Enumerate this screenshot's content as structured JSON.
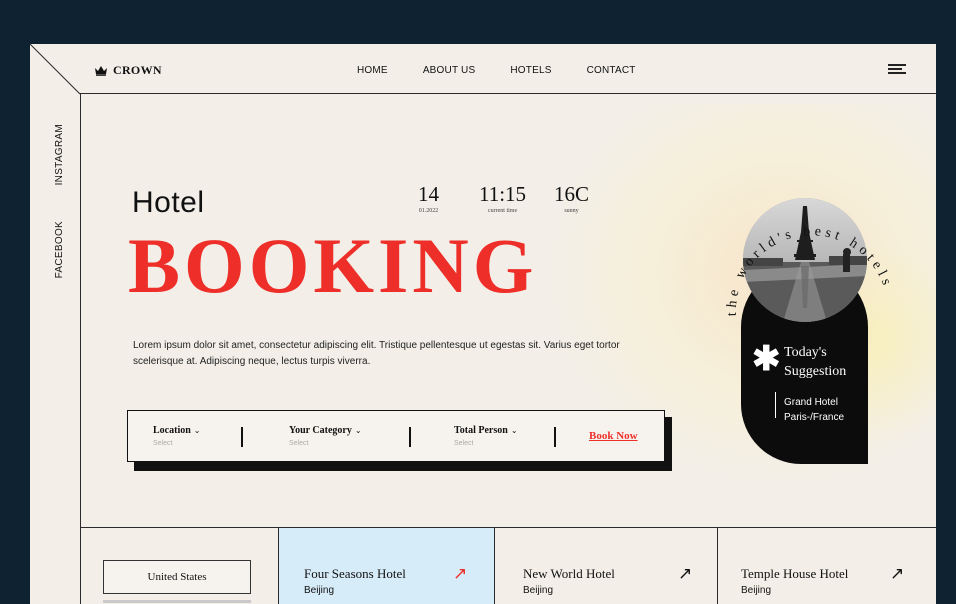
{
  "brand": {
    "name": "CROWN",
    "icon": "crown-icon"
  },
  "nav": [
    "HOME",
    "ABOUT US",
    "HOTELS",
    "CONTACT"
  ],
  "social": {
    "instagram": "INSTAGRAM",
    "facebook": "FACEBOOK"
  },
  "hero": {
    "title_top": "Hotel",
    "title_main": "BOOKING",
    "description": "Lorem ipsum dolor sit amet, consectetur adipiscing elit. Tristique pellentesque ut egestas sit. Varius eget tortor scelerisque at. Adipiscing neque, lectus turpis viverra."
  },
  "stats": [
    {
      "value": "14",
      "caption": "01.2022"
    },
    {
      "value": "11:15",
      "caption": "current time"
    },
    {
      "value": "16C",
      "caption": "sunny"
    }
  ],
  "search": {
    "fields": [
      {
        "label": "Location",
        "select": "Select"
      },
      {
        "label": "Your Category",
        "select": "Select"
      },
      {
        "label": "Total Person",
        "select": "Select"
      }
    ],
    "action": "Book Now"
  },
  "suggestion": {
    "curved_text": "the world's best hotels",
    "title_line1": "Today's",
    "title_line2": "Suggestion",
    "hotel_line1": "Grand Hotel",
    "hotel_line2": "Paris-/France"
  },
  "bottom": {
    "country": "United States",
    "hotels": [
      {
        "name": "Four Seasons Hotel",
        "city": "Beijing",
        "arrow_color": "#ee2f29"
      },
      {
        "name": "New World Hotel",
        "city": "Beijing",
        "arrow_color": "#111111"
      },
      {
        "name": "Temple House Hotel",
        "city": "Beijing",
        "arrow_color": "#111111"
      }
    ]
  },
  "colors": {
    "background": "#0f2232",
    "accent": "#ee2f29",
    "panel": "#f3efe8",
    "highlight_cell": "#d6ecf8"
  }
}
